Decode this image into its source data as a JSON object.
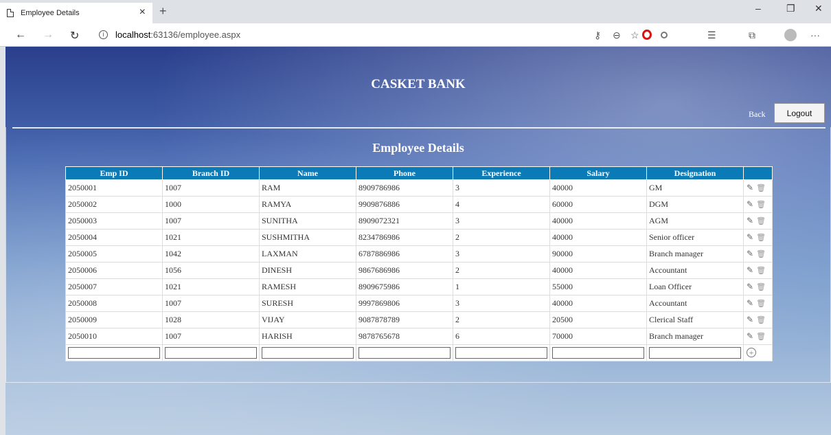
{
  "browser": {
    "tab_title": "Employee Details",
    "new_tab": "+",
    "url_host": "localhost",
    "url_path": ":63136/employee.aspx"
  },
  "page": {
    "bank_name": "CASKET BANK",
    "back_label": "Back",
    "logout_label": "Logout",
    "section_title": "Employee Details"
  },
  "table": {
    "headers": [
      "Emp ID",
      "Branch ID",
      "Name",
      "Phone",
      "Experience",
      "Salary",
      "Designation"
    ],
    "rows": [
      [
        "2050001",
        "1007",
        "RAM",
        "8909786986",
        "3",
        "40000",
        "GM"
      ],
      [
        "2050002",
        "1000",
        "RAMYA",
        "9909876886",
        "4",
        "60000",
        "DGM"
      ],
      [
        "2050003",
        "1007",
        "SUNITHA",
        "8909072321",
        "3",
        "40000",
        "AGM"
      ],
      [
        "2050004",
        "1021",
        "SUSHMITHA",
        "8234786986",
        "2",
        "40000",
        "Senior officer"
      ],
      [
        "2050005",
        "1042",
        "LAXMAN",
        "6787886986",
        "3",
        "90000",
        "Branch manager"
      ],
      [
        "2050006",
        "1056",
        "DINESH",
        "9867686986",
        "2",
        "40000",
        "Accountant"
      ],
      [
        "2050007",
        "1021",
        "RAMESH",
        "8909675986",
        "1",
        "55000",
        "Loan Officer"
      ],
      [
        "2050008",
        "1007",
        "SURESH",
        "9997869806",
        "3",
        "40000",
        "Accountant"
      ],
      [
        "2050009",
        "1028",
        "VIJAY",
        "9087878789",
        "2",
        "20500",
        "Clerical Staff"
      ],
      [
        "2050010",
        "1007",
        "HARISH",
        "9878765678",
        "6",
        "70000",
        "Branch manager"
      ]
    ]
  },
  "icons": {
    "edit": "pencil-icon",
    "delete": "trash-icon",
    "add": "add-circle-icon"
  }
}
